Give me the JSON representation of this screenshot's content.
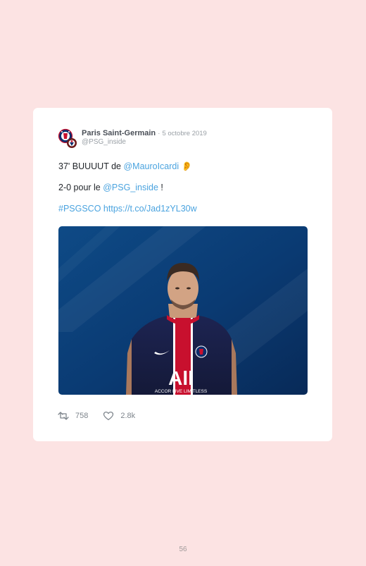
{
  "tweet": {
    "author_name": "Paris Saint-Germain",
    "separator": "·",
    "date": "5 octobre 2019",
    "handle": "@PSG_inside",
    "line1_prefix": "37' BUUUUT de ",
    "line1_mention": "@MauroIcardi",
    "line1_emoji": "👂",
    "line2_prefix": "2-0 pour le ",
    "line2_mention": "@PSG_inside",
    "line2_suffix": " !",
    "hashtag": "#PSGSCO",
    "url": "https://t.co/Jad1zYL30w",
    "media_jersey_text": "ACCOR LIVE LIMITLESS",
    "retweets": "758",
    "likes": "2.8k"
  },
  "icons": {
    "retweet": "retweet-icon",
    "like": "heart-icon",
    "avatar": "psg-club-avatar"
  },
  "colors": {
    "background": "#fce3e3",
    "card": "#ffffff",
    "link": "#4aa3df",
    "muted": "#9aa0a6"
  },
  "footer": {
    "page_number": "56"
  }
}
